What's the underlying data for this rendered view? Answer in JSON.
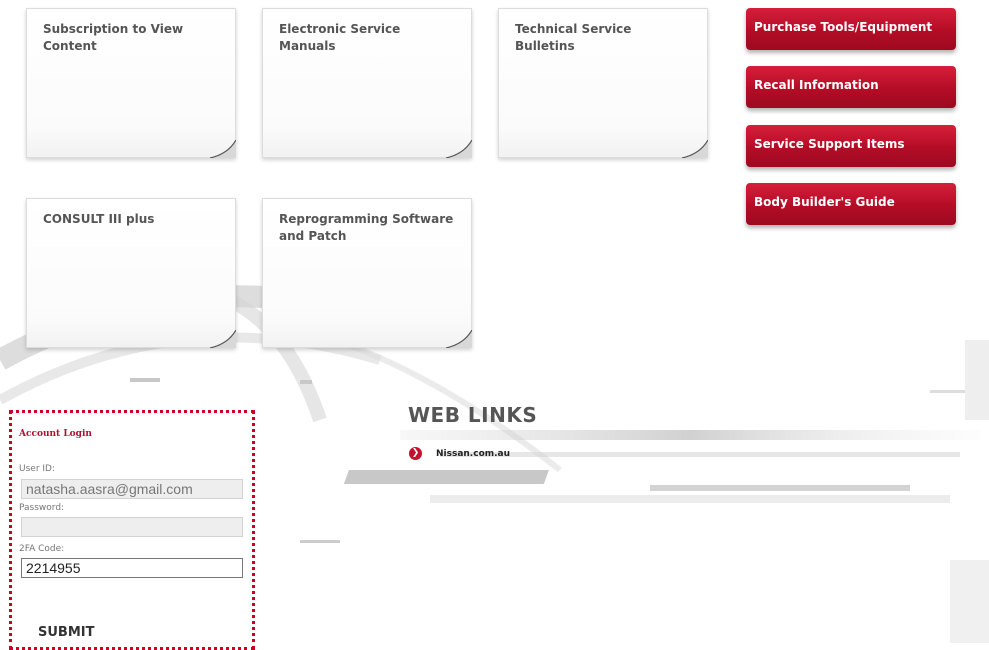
{
  "cards": [
    {
      "title": "Subscription to View Content"
    },
    {
      "title": "Electronic Service Manuals"
    },
    {
      "title": "Technical Service Bulletins"
    },
    {
      "title": "CONSULT III plus"
    },
    {
      "title": "Reprogramming Software and Patch"
    }
  ],
  "side_buttons": [
    {
      "label": "Purchase Tools/Equipment"
    },
    {
      "label": "Recall Information"
    },
    {
      "label": "Service Support Items"
    },
    {
      "label": "Body Builder's Guide"
    }
  ],
  "login": {
    "heading": "Account Login",
    "user_id_label": "User ID:",
    "user_id_value": "natasha.aasra@gmail.com",
    "password_label": "Password:",
    "password_value": "",
    "twofa_label": "2FA Code:",
    "twofa_value": "2214955",
    "submit_label": "SUBMIT"
  },
  "web_links": {
    "title": "WEB LINKS",
    "items": [
      {
        "label": "Nissan.com.au",
        "icon": "chevron-right-circle-icon"
      }
    ]
  },
  "colors": {
    "brand_red": "#c4112c",
    "login_border": "#cc0022"
  }
}
